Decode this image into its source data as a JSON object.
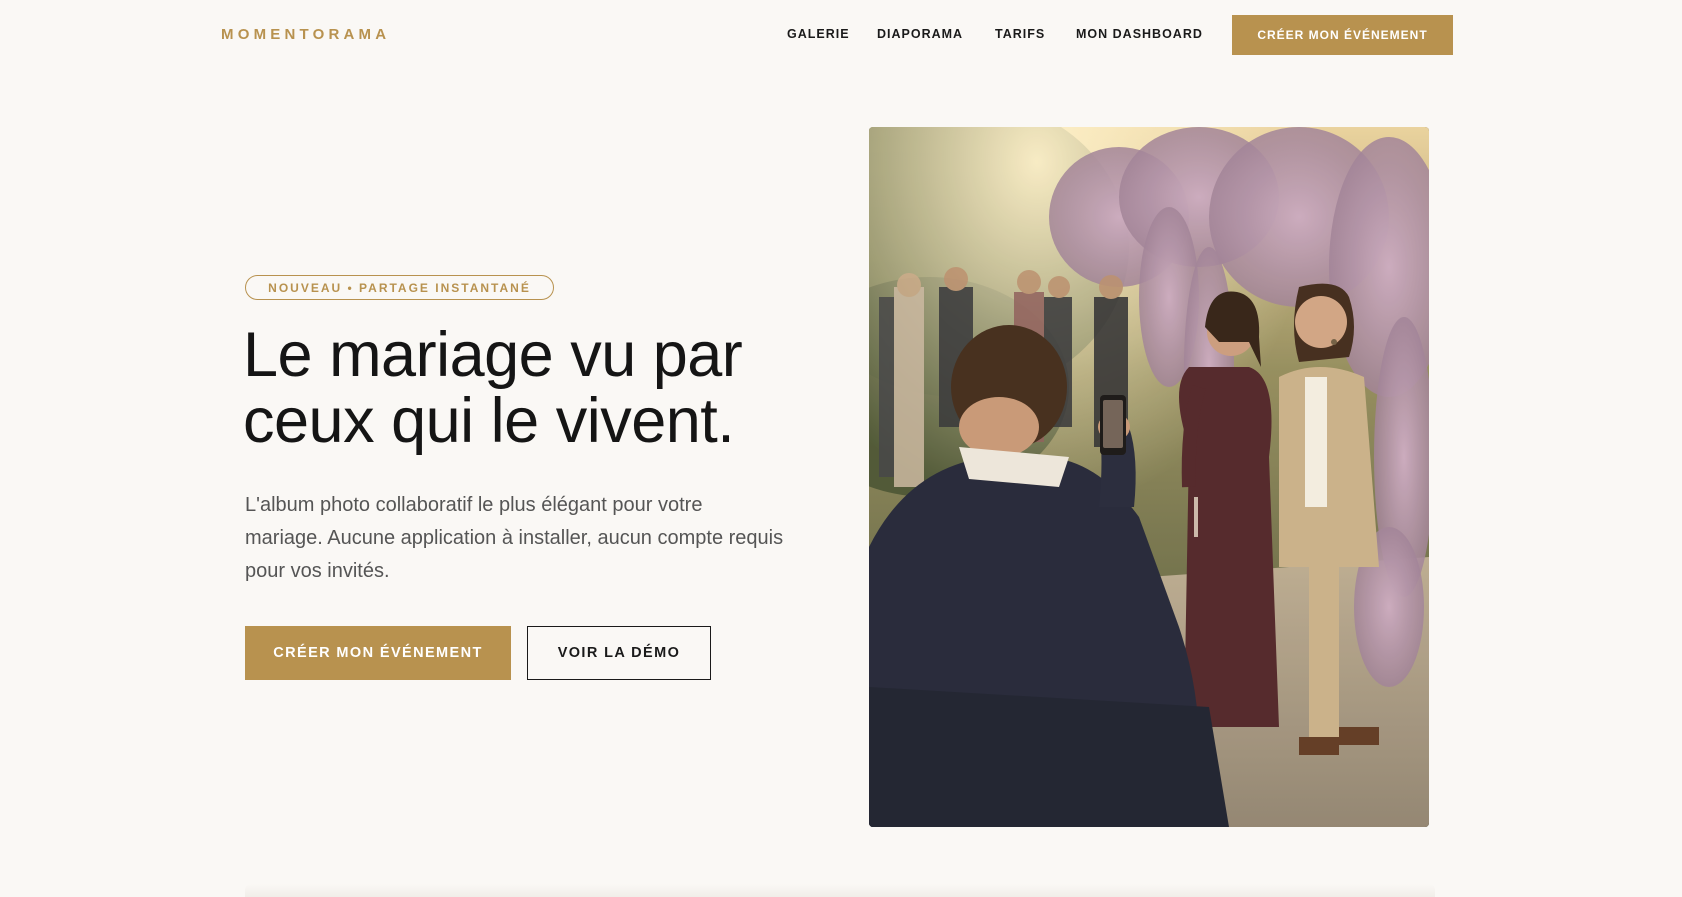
{
  "brand": {
    "name": "MOMENTORAMA",
    "accent_color": "#b8924f",
    "text_color": "#151515"
  },
  "nav": {
    "items": [
      {
        "label": "GALERIE"
      },
      {
        "label": "DIAPORAMA"
      },
      {
        "label": "TARIFS"
      },
      {
        "label": "MON DASHBOARD"
      }
    ],
    "cta_label": "CRÉER MON ÉVÉNEMENT"
  },
  "hero": {
    "badge": "NOUVEAU • PARTAGE INSTANTANÉ",
    "headline_line1": "Le mariage vu par",
    "headline_line2": "ceux qui le vivent.",
    "subtext": "L'album photo collaboratif le plus élégant pour votre mariage. Aucune application à installer, aucun compte requis pour vos invités.",
    "primary_cta": "CRÉER MON ÉVÉNEMENT",
    "secondary_cta": "VOIR LA DÉMO",
    "image_icon": "wedding-photo"
  }
}
